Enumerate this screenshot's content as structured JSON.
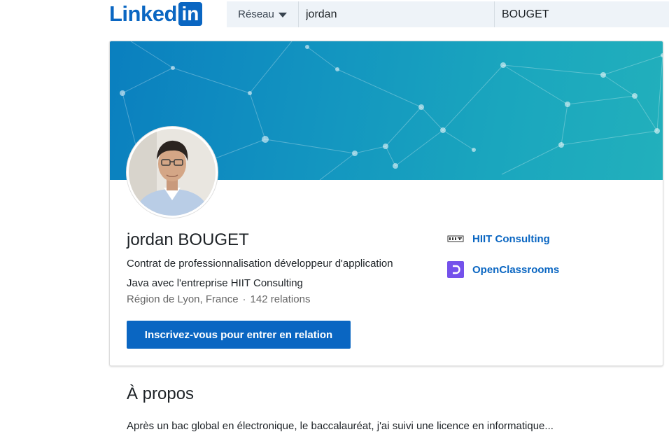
{
  "header": {
    "logo_text": "Linked",
    "logo_box_text": "in",
    "network_dropdown": "Réseau",
    "search_first_name": "jordan",
    "search_last_name": "BOUGET"
  },
  "profile": {
    "name": "jordan BOUGET",
    "headline_line1": "Contrat de professionnalisation développeur d'application",
    "headline_line2": "Java avec l'entreprise HIIT Consulting",
    "location": "Région de Lyon, France",
    "separator": "·",
    "connections": "142 relations",
    "connect_button": "Inscrivez-vous pour entrer en relation"
  },
  "companies": [
    {
      "name": "HIIT Consulting",
      "icon": "hiit-logo-icon"
    },
    {
      "name": "OpenClassrooms",
      "icon": "openclassrooms-logo-icon"
    }
  ],
  "about": {
    "title": "À propos",
    "text": "Après un bac global en électronique, le baccalauréat, j'ai suivi une licence en informatique..."
  },
  "colors": {
    "brand": "#0a66c2",
    "banner_start": "#0a7fbf",
    "banner_end": "#22b0bc"
  }
}
